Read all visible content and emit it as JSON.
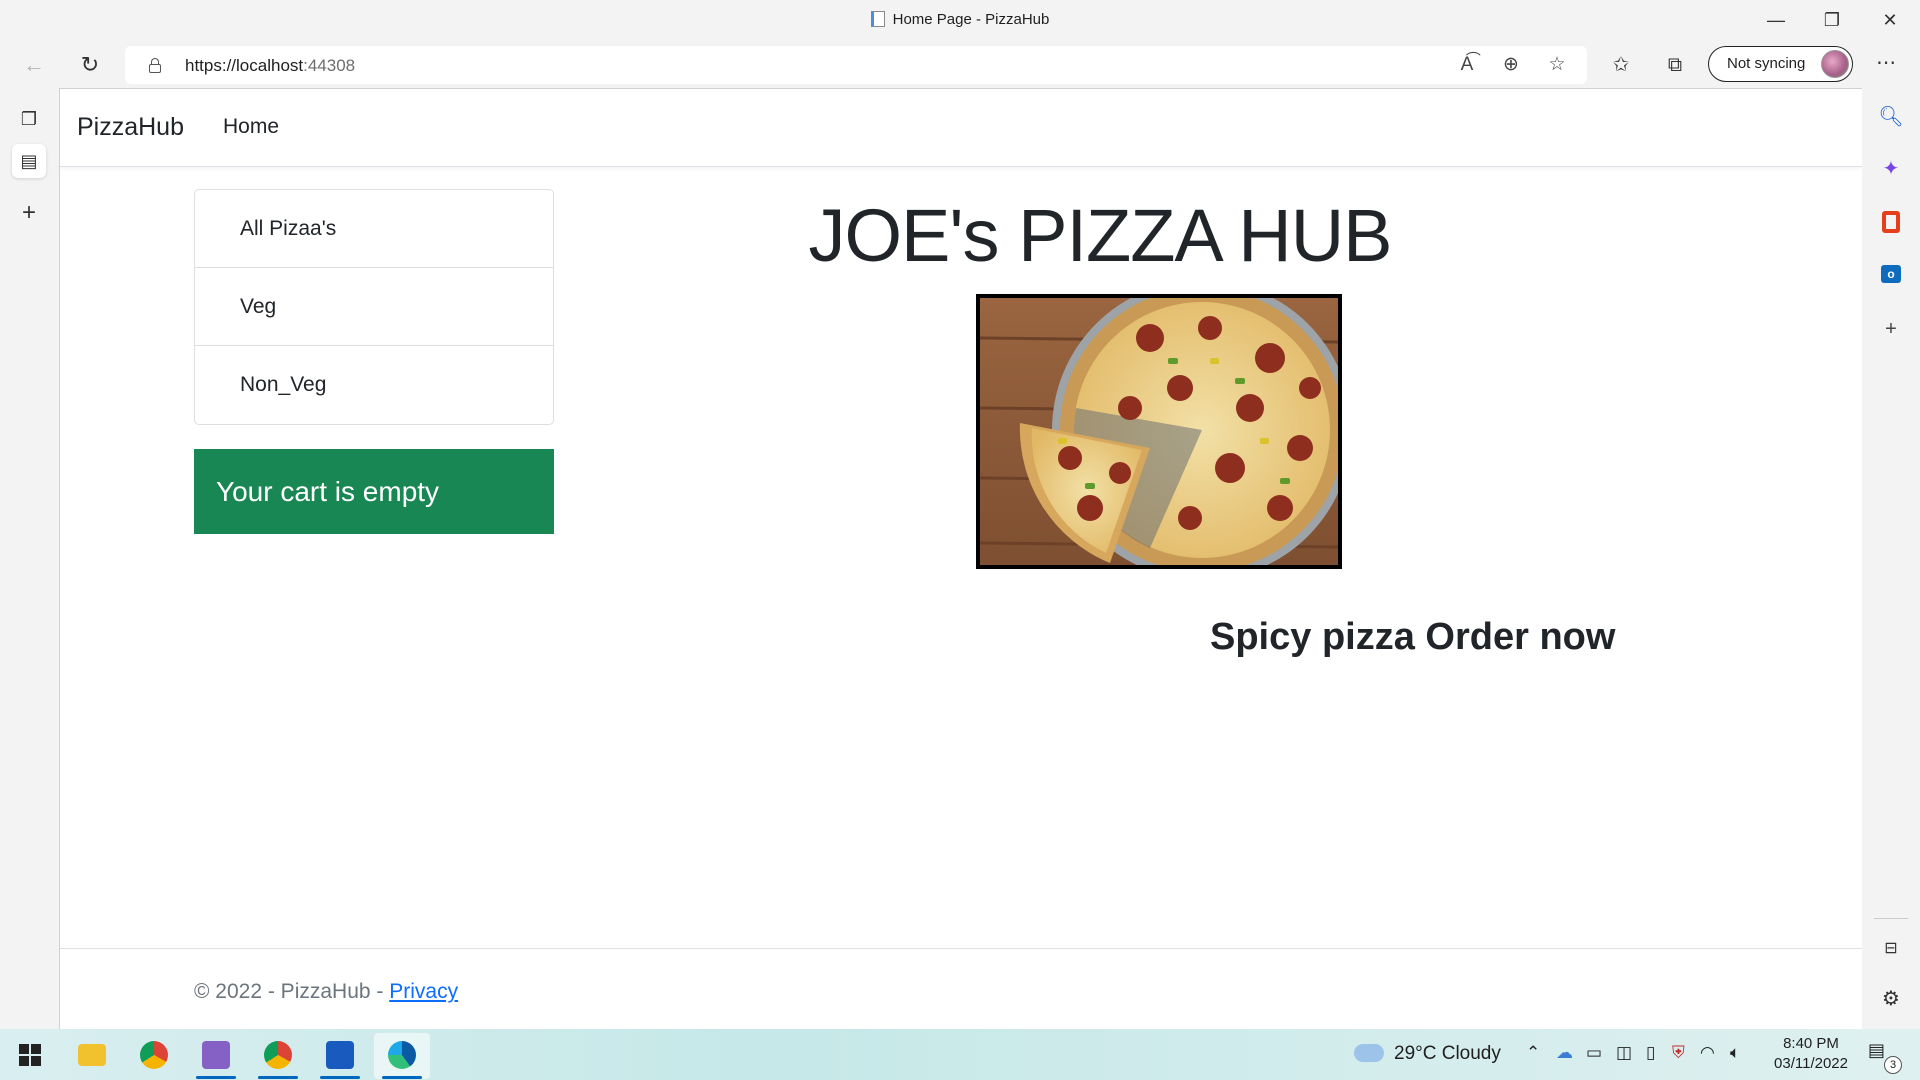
{
  "browser": {
    "tab_title": "Home Page - PizzaHub",
    "url_host": "https://localhost",
    "url_port": ":44308",
    "profile_label": "Not syncing",
    "window_controls": {
      "minimize": "—",
      "restore": "❐",
      "close": "✕"
    },
    "toolbar_icons": [
      "read-aloud-icon",
      "zoom-icon",
      "add-favorite-icon",
      "favorites-icon",
      "collections-icon",
      "more-icon"
    ],
    "sidebar_icons": [
      "search-icon",
      "copilot-icon",
      "office-icon",
      "outlook-icon",
      "add-icon",
      "split-screen-icon",
      "settings-icon"
    ]
  },
  "site": {
    "brand": "PizzaHub",
    "nav": {
      "home": "Home"
    },
    "categories": [
      "All Pizaa's",
      "Veg",
      "Non_Veg"
    ],
    "cart_status": "Your cart is empty",
    "hero_title": "JOE's PIZZA HUB",
    "promo_text": "Spicy pizza Order now",
    "footer": {
      "text": "© 2022 - PizzaHub - ",
      "privacy_link": "Privacy"
    }
  },
  "taskbar": {
    "apps": [
      "windows-start",
      "file-explorer",
      "chrome",
      "visual-studio",
      "chrome-profile",
      "word",
      "edge"
    ],
    "weather": "29°C  Cloudy",
    "time": "8:40 PM",
    "date": "03/11/2022",
    "notification_count": "3"
  }
}
